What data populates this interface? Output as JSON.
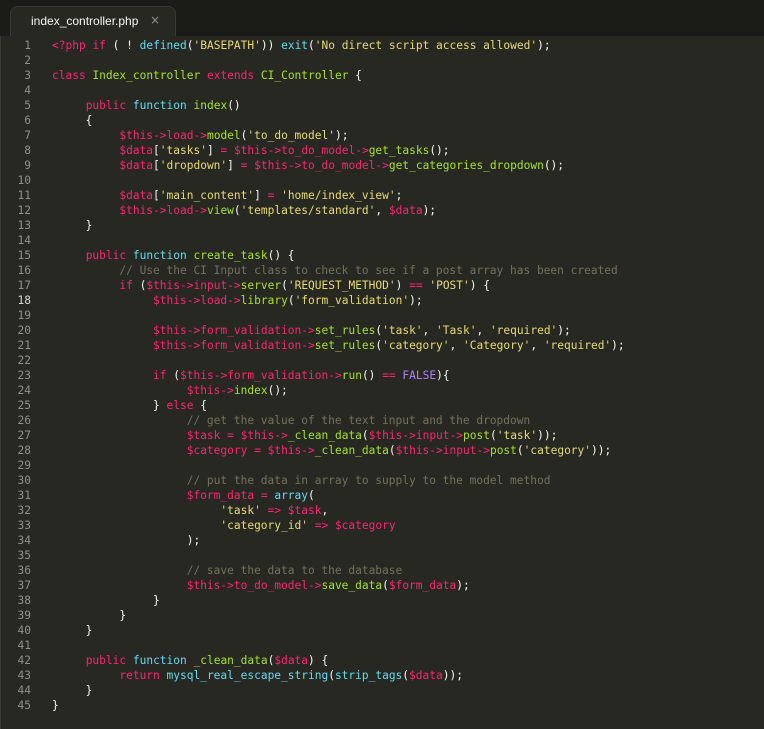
{
  "tab": {
    "filename": "index_controller.php",
    "close_glyph": "×"
  },
  "editor": {
    "current_line": 18,
    "lines": [
      [
        [
          "<?php",
          "tag"
        ],
        [
          " ",
          "txt"
        ],
        [
          "if",
          "kwp"
        ],
        [
          " ( ! ",
          "txt"
        ],
        [
          "defined",
          "kw"
        ],
        [
          "(",
          "txt"
        ],
        [
          "'BASEPATH'",
          "str"
        ],
        [
          ")) ",
          "txt"
        ],
        [
          "exit",
          "kw"
        ],
        [
          "(",
          "txt"
        ],
        [
          "'No direct script access allowed'",
          "str"
        ],
        [
          ");",
          "txt"
        ]
      ],
      [],
      [
        [
          "class",
          "kwp"
        ],
        [
          " ",
          "txt"
        ],
        [
          "Index_controller",
          "class"
        ],
        [
          " ",
          "txt"
        ],
        [
          "extends",
          "kwp"
        ],
        [
          " ",
          "txt"
        ],
        [
          "CI_Controller",
          "class"
        ],
        [
          " {",
          "txt"
        ]
      ],
      [],
      [
        [
          "     ",
          "txt"
        ],
        [
          "public",
          "kwp"
        ],
        [
          " ",
          "txt"
        ],
        [
          "function",
          "kw"
        ],
        [
          " ",
          "txt"
        ],
        [
          "index",
          "fn"
        ],
        [
          "()",
          "txt"
        ]
      ],
      [
        [
          "     {",
          "txt"
        ]
      ],
      [
        [
          "          ",
          "txt"
        ],
        [
          "$this",
          "var"
        ],
        [
          "->",
          "op"
        ],
        [
          "load",
          "var"
        ],
        [
          "->",
          "op"
        ],
        [
          "model",
          "fn"
        ],
        [
          "(",
          "txt"
        ],
        [
          "'to_do_model'",
          "str"
        ],
        [
          ");",
          "txt"
        ]
      ],
      [
        [
          "          ",
          "txt"
        ],
        [
          "$data",
          "var"
        ],
        [
          "[",
          "txt"
        ],
        [
          "'tasks'",
          "str"
        ],
        [
          "] ",
          "txt"
        ],
        [
          "=",
          "op"
        ],
        [
          " ",
          "txt"
        ],
        [
          "$this",
          "var"
        ],
        [
          "->",
          "op"
        ],
        [
          "to_do_model",
          "var"
        ],
        [
          "->",
          "op"
        ],
        [
          "get_tasks",
          "fn"
        ],
        [
          "();",
          "txt"
        ]
      ],
      [
        [
          "          ",
          "txt"
        ],
        [
          "$data",
          "var"
        ],
        [
          "[",
          "txt"
        ],
        [
          "'dropdown'",
          "str"
        ],
        [
          "] ",
          "txt"
        ],
        [
          "=",
          "op"
        ],
        [
          " ",
          "txt"
        ],
        [
          "$this",
          "var"
        ],
        [
          "->",
          "op"
        ],
        [
          "to_do_model",
          "var"
        ],
        [
          "->",
          "op"
        ],
        [
          "get_categories_dropdown",
          "fn"
        ],
        [
          "();",
          "txt"
        ]
      ],
      [],
      [
        [
          "          ",
          "txt"
        ],
        [
          "$data",
          "var"
        ],
        [
          "[",
          "txt"
        ],
        [
          "'main_content'",
          "str"
        ],
        [
          "] ",
          "txt"
        ],
        [
          "=",
          "op"
        ],
        [
          " ",
          "txt"
        ],
        [
          "'home/index_view'",
          "str"
        ],
        [
          ";",
          "txt"
        ]
      ],
      [
        [
          "          ",
          "txt"
        ],
        [
          "$this",
          "var"
        ],
        [
          "->",
          "op"
        ],
        [
          "load",
          "var"
        ],
        [
          "->",
          "op"
        ],
        [
          "view",
          "fn"
        ],
        [
          "(",
          "txt"
        ],
        [
          "'templates/standard'",
          "str"
        ],
        [
          ", ",
          "txt"
        ],
        [
          "$data",
          "var"
        ],
        [
          ");",
          "txt"
        ]
      ],
      [
        [
          "     }",
          "txt"
        ]
      ],
      [],
      [
        [
          "     ",
          "txt"
        ],
        [
          "public",
          "kwp"
        ],
        [
          " ",
          "txt"
        ],
        [
          "function",
          "kw"
        ],
        [
          " ",
          "txt"
        ],
        [
          "create_task",
          "fn"
        ],
        [
          "() {",
          "txt"
        ]
      ],
      [
        [
          "          ",
          "txt"
        ],
        [
          "// Use the CI Input class to check to see if a post array has been created",
          "com"
        ]
      ],
      [
        [
          "          ",
          "txt"
        ],
        [
          "if",
          "kwp"
        ],
        [
          " (",
          "txt"
        ],
        [
          "$this",
          "var"
        ],
        [
          "->",
          "op"
        ],
        [
          "input",
          "var"
        ],
        [
          "->",
          "op"
        ],
        [
          "server",
          "fn"
        ],
        [
          "(",
          "txt"
        ],
        [
          "'REQUEST_METHOD'",
          "str"
        ],
        [
          ") ",
          "txt"
        ],
        [
          "==",
          "op"
        ],
        [
          " ",
          "txt"
        ],
        [
          "'POST'",
          "str"
        ],
        [
          ") {",
          "txt"
        ]
      ],
      [
        [
          "               ",
          "txt"
        ],
        [
          "$this",
          "var"
        ],
        [
          "->",
          "op"
        ],
        [
          "load",
          "var"
        ],
        [
          "->",
          "op"
        ],
        [
          "library",
          "fn"
        ],
        [
          "(",
          "txt"
        ],
        [
          "'form_validation'",
          "str"
        ],
        [
          ");",
          "txt"
        ]
      ],
      [],
      [
        [
          "               ",
          "txt"
        ],
        [
          "$this",
          "var"
        ],
        [
          "->",
          "op"
        ],
        [
          "form_validation",
          "var"
        ],
        [
          "->",
          "op"
        ],
        [
          "set_rules",
          "fn"
        ],
        [
          "(",
          "txt"
        ],
        [
          "'task'",
          "str"
        ],
        [
          ", ",
          "txt"
        ],
        [
          "'Task'",
          "str"
        ],
        [
          ", ",
          "txt"
        ],
        [
          "'required'",
          "str"
        ],
        [
          ");",
          "txt"
        ]
      ],
      [
        [
          "               ",
          "txt"
        ],
        [
          "$this",
          "var"
        ],
        [
          "->",
          "op"
        ],
        [
          "form_validation",
          "var"
        ],
        [
          "->",
          "op"
        ],
        [
          "set_rules",
          "fn"
        ],
        [
          "(",
          "txt"
        ],
        [
          "'category'",
          "str"
        ],
        [
          ", ",
          "txt"
        ],
        [
          "'Category'",
          "str"
        ],
        [
          ", ",
          "txt"
        ],
        [
          "'required'",
          "str"
        ],
        [
          ");",
          "txt"
        ]
      ],
      [],
      [
        [
          "               ",
          "txt"
        ],
        [
          "if",
          "kwp"
        ],
        [
          " (",
          "txt"
        ],
        [
          "$this",
          "var"
        ],
        [
          "->",
          "op"
        ],
        [
          "form_validation",
          "var"
        ],
        [
          "->",
          "op"
        ],
        [
          "run",
          "fn"
        ],
        [
          "() ",
          "txt"
        ],
        [
          "==",
          "op"
        ],
        [
          " ",
          "txt"
        ],
        [
          "FALSE",
          "const"
        ],
        [
          "){",
          "txt"
        ]
      ],
      [
        [
          "                    ",
          "txt"
        ],
        [
          "$this",
          "var"
        ],
        [
          "->",
          "op"
        ],
        [
          "index",
          "fn"
        ],
        [
          "();",
          "txt"
        ]
      ],
      [
        [
          "               } ",
          "txt"
        ],
        [
          "else",
          "kwp"
        ],
        [
          " {",
          "txt"
        ]
      ],
      [
        [
          "                    ",
          "txt"
        ],
        [
          "// get the value of the text input and the dropdown",
          "com"
        ]
      ],
      [
        [
          "                    ",
          "txt"
        ],
        [
          "$task",
          "var"
        ],
        [
          " ",
          "txt"
        ],
        [
          "=",
          "op"
        ],
        [
          " ",
          "txt"
        ],
        [
          "$this",
          "var"
        ],
        [
          "->",
          "op"
        ],
        [
          "_clean_data",
          "fn"
        ],
        [
          "(",
          "txt"
        ],
        [
          "$this",
          "var"
        ],
        [
          "->",
          "op"
        ],
        [
          "input",
          "var"
        ],
        [
          "->",
          "op"
        ],
        [
          "post",
          "fn"
        ],
        [
          "(",
          "txt"
        ],
        [
          "'task'",
          "str"
        ],
        [
          "));",
          "txt"
        ]
      ],
      [
        [
          "                    ",
          "txt"
        ],
        [
          "$category",
          "var"
        ],
        [
          " ",
          "txt"
        ],
        [
          "=",
          "op"
        ],
        [
          " ",
          "txt"
        ],
        [
          "$this",
          "var"
        ],
        [
          "->",
          "op"
        ],
        [
          "_clean_data",
          "fn"
        ],
        [
          "(",
          "txt"
        ],
        [
          "$this",
          "var"
        ],
        [
          "->",
          "op"
        ],
        [
          "input",
          "var"
        ],
        [
          "->",
          "op"
        ],
        [
          "post",
          "fn"
        ],
        [
          "(",
          "txt"
        ],
        [
          "'category'",
          "str"
        ],
        [
          "));",
          "txt"
        ]
      ],
      [],
      [
        [
          "                    ",
          "txt"
        ],
        [
          "// put the data in array to supply to the model method",
          "com"
        ]
      ],
      [
        [
          "                    ",
          "txt"
        ],
        [
          "$form_data",
          "var"
        ],
        [
          " ",
          "txt"
        ],
        [
          "=",
          "op"
        ],
        [
          " ",
          "txt"
        ],
        [
          "array",
          "kw"
        ],
        [
          "(",
          "txt"
        ]
      ],
      [
        [
          "                         ",
          "txt"
        ],
        [
          "'task'",
          "str"
        ],
        [
          " ",
          "txt"
        ],
        [
          "=>",
          "op"
        ],
        [
          " ",
          "txt"
        ],
        [
          "$task",
          "var"
        ],
        [
          ",",
          "txt"
        ]
      ],
      [
        [
          "                         ",
          "txt"
        ],
        [
          "'category_id'",
          "str"
        ],
        [
          " ",
          "txt"
        ],
        [
          "=>",
          "op"
        ],
        [
          " ",
          "txt"
        ],
        [
          "$category",
          "var"
        ]
      ],
      [
        [
          "                    );",
          "txt"
        ]
      ],
      [],
      [
        [
          "                    ",
          "txt"
        ],
        [
          "// save the data to the database",
          "com"
        ]
      ],
      [
        [
          "                    ",
          "txt"
        ],
        [
          "$this",
          "var"
        ],
        [
          "->",
          "op"
        ],
        [
          "to_do_model",
          "var"
        ],
        [
          "->",
          "op"
        ],
        [
          "save_data",
          "fn"
        ],
        [
          "(",
          "txt"
        ],
        [
          "$form_data",
          "var"
        ],
        [
          ");",
          "txt"
        ]
      ],
      [
        [
          "               }",
          "txt"
        ]
      ],
      [
        [
          "          }",
          "txt"
        ]
      ],
      [
        [
          "     }",
          "txt"
        ]
      ],
      [],
      [
        [
          "     ",
          "txt"
        ],
        [
          "public",
          "kwp"
        ],
        [
          " ",
          "txt"
        ],
        [
          "function",
          "kw"
        ],
        [
          " ",
          "txt"
        ],
        [
          "_clean_data",
          "fn"
        ],
        [
          "(",
          "txt"
        ],
        [
          "$data",
          "var"
        ],
        [
          ") {",
          "txt"
        ]
      ],
      [
        [
          "          ",
          "txt"
        ],
        [
          "return",
          "kwp"
        ],
        [
          " ",
          "txt"
        ],
        [
          "mysql_real_escape_string",
          "kw"
        ],
        [
          "(",
          "txt"
        ],
        [
          "strip_tags",
          "kw"
        ],
        [
          "(",
          "txt"
        ],
        [
          "$data",
          "var"
        ],
        [
          "));",
          "txt"
        ]
      ],
      [
        [
          "     }",
          "txt"
        ]
      ],
      [
        [
          "}",
          "txt"
        ]
      ]
    ]
  }
}
